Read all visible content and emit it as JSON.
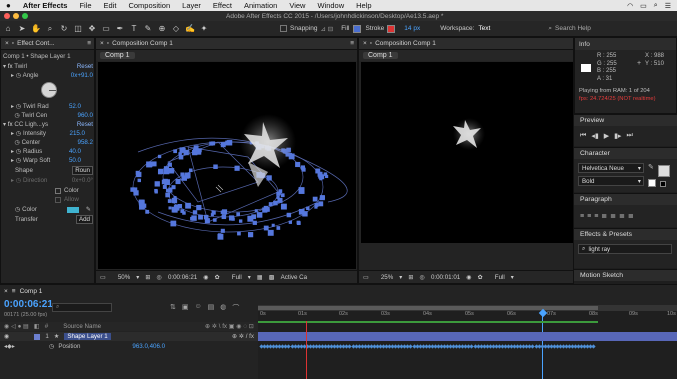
{
  "menubar": {
    "apple": "",
    "app": "After Effects",
    "items": [
      "File",
      "Edit",
      "Composition",
      "Layer",
      "Effect",
      "Animation",
      "View",
      "Window",
      "Help"
    ]
  },
  "titlebar": {
    "title": "Adobe After Effects CC 2015 - /Users/johnhdickinson/Desktop/Ae13.5.aep *"
  },
  "toolbar": {
    "snapping": "Snapping",
    "fill": "Fill",
    "stroke": "Stroke",
    "stroke_px": "14 px",
    "workspace_label": "Workspace:",
    "workspace": "Text",
    "search": "Search Help"
  },
  "effect_controls": {
    "tab": "Effect Cont...",
    "layer_path": "Comp 1 • Shape Layer 1",
    "rows": [
      {
        "label": "Twirl",
        "value": "Reset"
      },
      {
        "label": "Angle",
        "value": "0x+91.0"
      },
      {
        "label": "Twirl Rad",
        "value": "52.0"
      },
      {
        "label": "Twirl Cen",
        "value": "960.0"
      },
      {
        "label": "CC Ligh...ys",
        "value": "Reset"
      },
      {
        "label": "Intensity",
        "value": "215.0"
      },
      {
        "label": "Center",
        "value": "958.2"
      },
      {
        "label": "Radius",
        "value": "40.0"
      },
      {
        "label": "Warp Soft",
        "value": "50.0"
      },
      {
        "label": "Shape",
        "value": "Roun"
      },
      {
        "label": "Direction",
        "value": "0x+0.0°"
      },
      {
        "label": "",
        "value": "Color"
      },
      {
        "label": "",
        "value": "Allow"
      },
      {
        "label": "Color",
        "value": ""
      },
      {
        "label": "Transfer",
        "value": "Add"
      }
    ]
  },
  "comp_left": {
    "tab": "Composition Comp 1",
    "subtab": "Comp 1",
    "zoom": "50%",
    "time": "0:00:06:21",
    "resolution": "Full",
    "camera": "Active Ca"
  },
  "comp_right": {
    "tab": "Composition Comp 1",
    "subtab": "Comp 1",
    "zoom": "25%",
    "time": "0:00:01:01",
    "resolution": "Full"
  },
  "info": {
    "title": "Info",
    "rgba": [
      "R : 255",
      "G : 255",
      "B : 255",
      "A : 31"
    ],
    "xy": [
      "X : 988",
      "Y : 510"
    ],
    "playing": "Playing from RAM: 1 of 204",
    "fps": "fps: 24.724/25 (NOT realtime)"
  },
  "preview": {
    "title": "Preview"
  },
  "character": {
    "title": "Character",
    "font": "Helvetica Neue",
    "style": "Bold"
  },
  "paragraph": {
    "title": "Paragraph"
  },
  "effects_presets": {
    "title": "Effects & Presets",
    "search": "light ray"
  },
  "motion_sketch": {
    "title": "Motion Sketch"
  },
  "timeline": {
    "tab": "Comp 1",
    "timecode": "0:00:06:21",
    "frames": "00171 (25.00 fps)",
    "col_source": "Source Name",
    "layer": "Shape Layer 1",
    "position_label": "Position",
    "position_value": "963.0,406.0",
    "ruler": [
      "0s",
      "01s",
      "02s",
      "03s",
      "04s",
      "05s",
      "06s",
      "07s",
      "08s",
      "09s",
      "10s"
    ]
  }
}
